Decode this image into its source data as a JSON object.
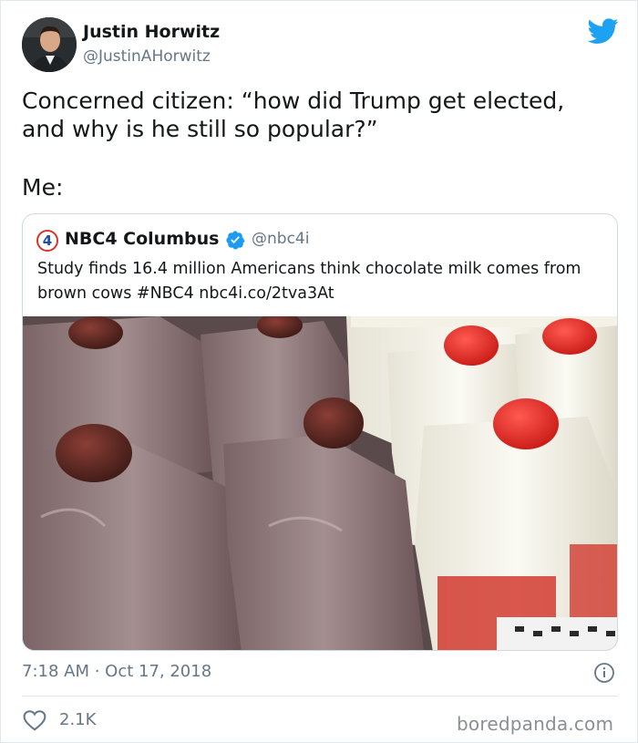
{
  "author": {
    "name": "Justin Horwitz",
    "handle": "@JustinAHorwitz"
  },
  "tweet": {
    "text": "Concerned citizen: “how did Trump get elected, and why is he still so popular?”",
    "text_2": "Me:"
  },
  "quoted": {
    "logo_number": "4",
    "name": "NBC4 Columbus",
    "handle": "@nbc4i",
    "text": "Study finds 16.4 million Americans think chocolate milk comes from brown cows #NBC4 nbc4i.co/2tva3At",
    "image_description": "photo-milk-jugs"
  },
  "meta": {
    "timestamp": "7:18 AM · Oct 17, 2018",
    "likes": "2.1K"
  },
  "watermark": "boredpanda.com",
  "colors": {
    "twitter_blue": "#1da1f2",
    "secondary_text": "#657786",
    "verified": "#1d9bf0",
    "nbc_red": "#d8352a"
  },
  "icons": [
    "twitter-bird-icon",
    "verified-badge-icon",
    "info-icon",
    "heart-icon"
  ]
}
